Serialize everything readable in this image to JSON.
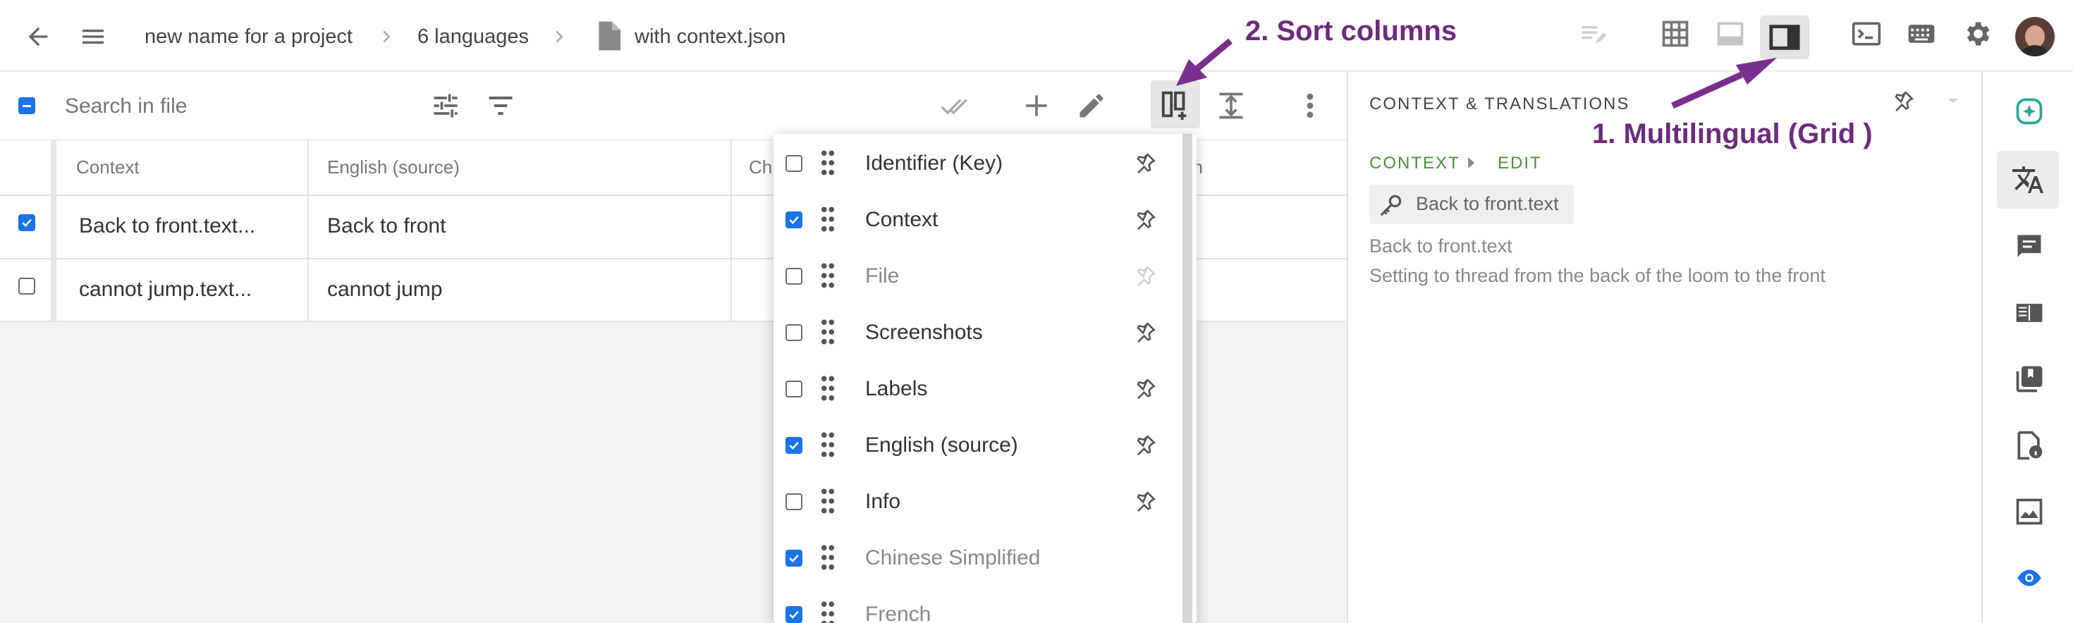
{
  "topbar": {
    "breadcrumb": {
      "project": "new name for a project",
      "languages": "6 languages",
      "file": "with context.json"
    }
  },
  "toolbar": {
    "search_placeholder": "Search in file"
  },
  "grid": {
    "columns": [
      "Context",
      "English (source)",
      "Ch",
      "nch"
    ],
    "rows": [
      {
        "checked": true,
        "context": "Back to front.text...",
        "source": "Back to front"
      },
      {
        "checked": false,
        "context": "cannot jump.text...",
        "source": "cannot jump"
      }
    ]
  },
  "column_menu": {
    "items": [
      {
        "label": "Identifier (Key)",
        "checked": false,
        "dim": false
      },
      {
        "label": "Context",
        "checked": true,
        "dim": false
      },
      {
        "label": "File",
        "checked": false,
        "dim": true
      },
      {
        "label": "Screenshots",
        "checked": false,
        "dim": false
      },
      {
        "label": "Labels",
        "checked": false,
        "dim": false
      },
      {
        "label": "English (source)",
        "checked": true,
        "dim": false
      },
      {
        "label": "Info",
        "checked": false,
        "dim": false
      },
      {
        "label": "Chinese Simplified",
        "checked": true,
        "dim": true
      },
      {
        "label": "French",
        "checked": true,
        "dim": true
      }
    ]
  },
  "right_panel": {
    "title": "CONTEXT & TRANSLATIONS",
    "context_tab": "CONTEXT",
    "edit_link": "EDIT",
    "key_chip": "Back to front.text",
    "key_line": "Back to front.text",
    "description": "Setting to thread from the back of the loom to the front"
  },
  "annotations": {
    "sort_columns": "2. Sort columns",
    "multilingual": "1. Multilingual (Grid )"
  },
  "colors": {
    "accent": "#1a73e8",
    "annotation": "#6e2a7e",
    "green": "#4d8f3c"
  }
}
